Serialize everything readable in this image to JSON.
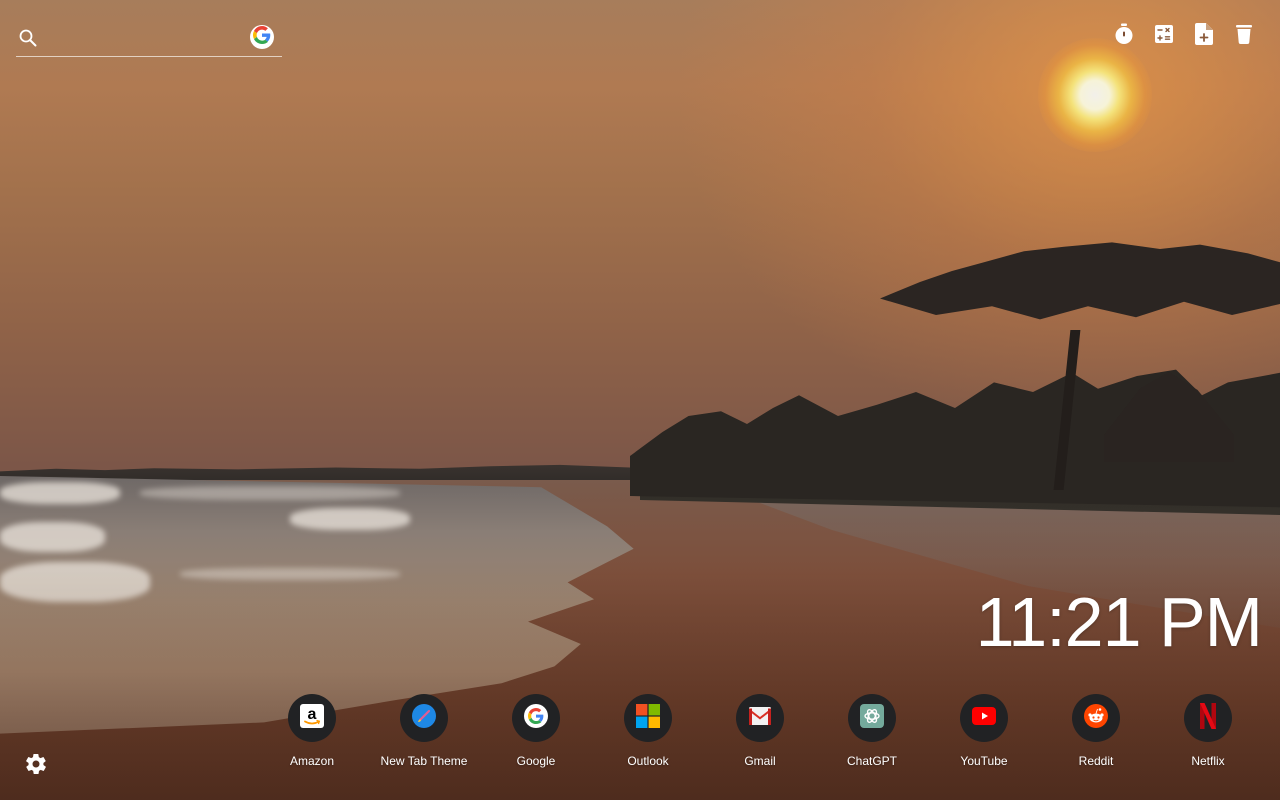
{
  "search": {
    "placeholder": "",
    "value": "",
    "engine": "Google",
    "engine_icon": "google-g-icon"
  },
  "toolbar": [
    {
      "name": "timer",
      "icon": "stopwatch-icon"
    },
    {
      "name": "calculator",
      "icon": "calculator-icon"
    },
    {
      "name": "add-note",
      "icon": "file-plus-icon"
    },
    {
      "name": "trash",
      "icon": "trash-icon"
    }
  ],
  "clock": {
    "time": "11:21 PM"
  },
  "shortcuts": [
    {
      "label": "Amazon",
      "icon": "amazon-icon"
    },
    {
      "label": "New Tab Theme",
      "icon": "paintbrush-icon"
    },
    {
      "label": "Google",
      "icon": "google-icon"
    },
    {
      "label": "Outlook",
      "icon": "microsoft-icon"
    },
    {
      "label": "Gmail",
      "icon": "gmail-icon"
    },
    {
      "label": "ChatGPT",
      "icon": "chatgpt-icon"
    },
    {
      "label": "YouTube",
      "icon": "youtube-icon"
    },
    {
      "label": "Reddit",
      "icon": "reddit-icon"
    },
    {
      "label": "Netflix",
      "icon": "netflix-icon"
    }
  ],
  "settings": {
    "icon": "gear-icon"
  },
  "wallpaper": {
    "description": "Sunset over a lakeside beach with silhouetted trees and a thatched hut"
  },
  "colors": {
    "tile_background": "#212224",
    "text": "#ffffff",
    "netflix_red": "#e50914",
    "youtube_red": "#ff0000",
    "reddit_orange": "#ff4500",
    "chatgpt_green": "#74aa9c"
  }
}
